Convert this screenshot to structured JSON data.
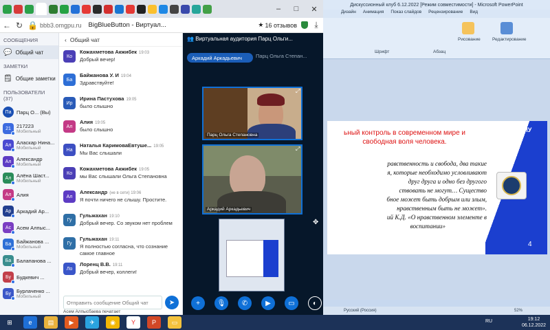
{
  "browser": {
    "url": "bbb3.omgpu.ru",
    "page_title": "BigBlueButton - Виртуал...",
    "reviews": "16 отзывов",
    "tab_colors": [
      "#2ba14a",
      "#d73a3a",
      "#2ba14a",
      "#ffffff",
      "#2e7d32",
      "#25a244",
      "#2471d8",
      "#e53935",
      "#2b2b2b",
      "#d32f2f",
      "#1976d2",
      "#e53935",
      "#222222",
      "#fbc02d",
      "#1e88e5",
      "#444444",
      "#3949ab",
      "#26a69a",
      "#43a047"
    ]
  },
  "sidebar": {
    "messages_heading": "СООБЩЕНИЯ",
    "public_chat": "Общий чат",
    "notes_heading": "ЗАМЕТКИ",
    "shared_notes": "Общие заметки",
    "users_heading": "ПОЛЬЗОВАТЕЛИ (37)",
    "users": [
      {
        "initials": "Па",
        "name": "Парц О... (Вы)",
        "sub": "",
        "color": "#1a4fb3",
        "round": true
      },
      {
        "initials": "21",
        "name": "217223",
        "sub": "Мобильный",
        "color": "#3c6be0",
        "round": false
      },
      {
        "initials": "Ал",
        "name": "Аласкар Нина...",
        "sub": "Мобильный",
        "color": "#4a4ad1",
        "round": false
      },
      {
        "initials": "Ал",
        "name": "Александр",
        "sub": "Мобильный",
        "color": "#5d3cc4",
        "round": false
      },
      {
        "initials": "Ал",
        "name": "Алёна Шаст...",
        "sub": "Мобильный",
        "color": "#2a8c5a",
        "round": false
      },
      {
        "initials": "Ал",
        "name": "Алия",
        "sub": "",
        "color": "#c43a86",
        "round": false
      },
      {
        "initials": "Ар",
        "name": "Аркадий Ар...",
        "sub": "",
        "color": "#223f8f",
        "round": false
      },
      {
        "initials": "Ас",
        "name": "Асем Алпыс...",
        "sub": "",
        "color": "#7a3ec2",
        "round": false
      },
      {
        "initials": "Ба",
        "name": "Байжанова ...",
        "sub": "Мобильный",
        "color": "#2e6fd6",
        "round": false
      },
      {
        "initials": "Ба",
        "name": "Балапанова ...",
        "sub": "",
        "color": "#3a8e8e",
        "round": false
      },
      {
        "initials": "Бу",
        "name": "Будкевич ...",
        "sub": "",
        "color": "#c23f4a",
        "round": false
      },
      {
        "initials": "Бу",
        "name": "Бурлаченко ...",
        "sub": "Мобильный",
        "color": "#3b57c8",
        "round": false
      }
    ]
  },
  "chat": {
    "title": "Общий чат",
    "messages": [
      {
        "initials": "Ко",
        "name": "Кожахметова Акжибек",
        "time": "19:03",
        "text": "Добрый вечер!",
        "color": "#4b3fb6"
      },
      {
        "initials": "Ба",
        "name": "Байжанова У. И",
        "time": "19:04",
        "text": "Здравствуйте!",
        "color": "#2e6fd6"
      },
      {
        "initials": "Ир",
        "name": "Ирина Пастухова",
        "time": "19:05",
        "text": "было слышно",
        "color": "#2a5bb8"
      },
      {
        "initials": "Ал",
        "name": "Алия",
        "time": "19:05",
        "text": "было слышно",
        "color": "#c43a86"
      },
      {
        "initials": "На",
        "name": "Наталья КаримоваЕвтуше...",
        "time": "19:05",
        "text": "Мы Вас слышали",
        "color": "#3d4fc2"
      },
      {
        "initials": "Ко",
        "name": "Кожахметова Акжибек",
        "time": "19:05",
        "text": "мы Вас слышали Ольга Степановна",
        "color": "#4b3fb6"
      },
      {
        "initials": "Ал",
        "name": "Александр",
        "time": "(не в сети) 19:06",
        "text": "Я почти ничего не слышу. Простите.",
        "color": "#5d3cc4"
      },
      {
        "initials": "Гу",
        "name": "Гульжахан",
        "time": "19:10",
        "text": "Добрый вечер. Со звуком нет проблем",
        "color": "#2f6fa6"
      },
      {
        "initials": "Гу",
        "name": "Гульжахан",
        "time": "19:11",
        "text": "Я полностью согласна, что сознание самое главное",
        "color": "#2f6fa6"
      },
      {
        "initials": "Ло",
        "name": "Лоренц В.В.",
        "time": "19:11",
        "text": "Добрый вечер, коллеги!",
        "color": "#3a56c9"
      }
    ],
    "input_placeholder": "Отправить сообщение Общий чат",
    "typing": "Асем Алпысбаева печатает"
  },
  "stage": {
    "title": "Виртуальная аудитория Парц Ольги...",
    "presenter": "Аркадий Аркадьевич",
    "presenter2": "Парц Ольга Степан...",
    "video1_label": "Парц Ольга Степановна",
    "video2_label": "Аркадий Аркадьевич"
  },
  "ppt": {
    "title": "Дискуссионный клуб 6.12.2022 [Режим совместимости] - Microsoft PowerPoint",
    "tabs": [
      "Дизайн",
      "Анимация",
      "Показ слайдов",
      "Рецензирование",
      "Вид"
    ],
    "ribbon_groups": [
      "Шрифт",
      "Абзац",
      "Рисование",
      "Редактирование"
    ],
    "slide_heading": "ьный контроль в современном мире и свободная воля человека.",
    "slide_lines": [
      "равственность и свобода, два такие",
      "я, которые необходимо условливают",
      "друг друга и одно без другого",
      "ствовать не могут… Существо",
      "бное может быть добрым или злым,",
      "нравственным быть не может».",
      "ий К.Д. «О нравственном элементе в",
      "воспитании»"
    ],
    "slide_logo": "90 ОмГПУ",
    "slide_number": "4",
    "status_lang": "Русский (Россия)",
    "zoom": "52%"
  },
  "taskbar": {
    "lang": "RU",
    "time": "19:12",
    "date": "06.12.2022"
  }
}
